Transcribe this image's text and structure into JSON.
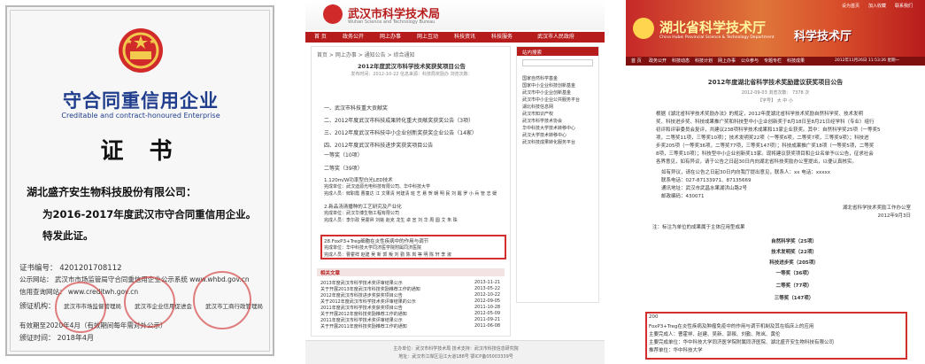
{
  "certificate": {
    "title": "守合同重信用企业",
    "subtitle": "Creditable and contract-honoured Enterprise",
    "heading": "证 书",
    "body_line1": "湖北盛齐安生物科技股份有限公司：",
    "body_line2": "为2016-2017年度武汉市守合同重信用企业。",
    "body_line3": "特发此证。",
    "cert_no": "证书编号：   4201201708112",
    "publicity": "公示网站：   武汉市市场监管局守合同重信用企业公示系统   www.whbd.gov.cn",
    "credit_site": "信用查询网站：   www.creditwh.gov.cn",
    "issuer_label": "颁证机构：",
    "issuer_1": "武汉市市场监督管理局",
    "issuer_2": "武汉市企业信用促进会",
    "issuer_3": "武汉市工商行政管理局",
    "validity": "有效期至2020年4月（有效期间每年需对外公示）",
    "issue_date": "颁证时间：   2018年4月"
  },
  "wuhan_page": {
    "site_title": "武汉市科学技术局",
    "site_title_en": "Wuhan Science and Technology Bureau",
    "nav": [
      "首 页",
      "政务公开",
      "网上办事",
      "网上互动",
      "科技资讯",
      "科技服务",
      "武汉市人民政府"
    ],
    "breadcrumb": "首页 > 网上办事 > 通知公告 > 综合通知",
    "article_title": "2012年度武汉市科学技术奖获奖项目公告",
    "article_meta": "发布时间：2012-10-22   信息来源：科技局奖励办   浏览次数：",
    "list_items": [
      "一、武汉市科技重大贡献奖",
      "二、2012年度武汉市科技成果转化重大贡献奖获奖公告（3项）",
      "三、2012年度武汉市科技中小企业创新奖获奖企业公告（14家）",
      "四、2012年度武汉市科技进步奖获奖项目公告",
      "一等奖（10项）",
      "二等奖（39项）"
    ],
    "project_1_title": "1.120m/W功率型白光LED技术",
    "project_1_unit": "完成单位：武汉迪源光电科技有限公司、华中科技大学",
    "project_1_people": "完成人员：鲜职霞 曹童达 江 文果清 何建清 班 艺 悬 贺 朝 明 民 刘 醒 罗 小 兵 管 志 媛",
    "project_2_title": "2.新品汤清播种的工艺研究及产业化",
    "project_2_unit": "完成单位：武汉华博生物工程有限公司",
    "project_2_people": "完成人员：李尔政 吴霍昇 刘姚 赵克 龙生 卓 宣 刘 华 周 圆 艾 朱 珠",
    "highlight_title": "28.FoxP3+Treg细胞在炎性疾病中的作用与调节",
    "highlight_unit": "完成单位：华中科技大学同济医学院附属同济医院",
    "highlight_people": "完成人员：曹霍祥 赵建 吴 新 郭 叛 刘 勤 陈 岚 等 明 陈 轩 李 淑",
    "related_header": "相关文章",
    "related": [
      "2013年度武汉市科学技术奖评审结果公示",
      "关于开展2013年度武汉市科技奖励推荐工作的通知",
      "2012年度武汉市科技进步奖获奖项目公告",
      "关于2012年度武汉市科学技术奖评审结果的公示",
      "2011年度武汉市科学技术奖获奖项目公告",
      "关于开展2012年度科技奖励推荐工作的通知",
      "2011年度武汉市科学技术奖评审结果公示",
      "关于开展2011年度科技奖励推荐工作的通知"
    ],
    "related_dates": [
      "2013-11-21",
      "2013-05-22",
      "2012-10-22",
      "2012-09-05",
      "2011-10-28",
      "2012-05-09",
      "2011-09-21",
      "2011-06-08"
    ],
    "sidebar_header": "站内搜索",
    "sidebar_links": [
      "国家自然科学基金",
      "国家中小企业科技创新基金",
      "武汉市中小企业创新基金",
      "武汉市中小企业公共服务平台",
      "湖北科技信息网",
      "武汉市知识产权",
      "武汉市科学技术协会",
      "华中科技大学技术转移中心",
      "武汉大学技术转移中心",
      "武汉科技成果转化服务平台"
    ],
    "footer_1": "主办单位：武汉市科学技术局  技术支持：武汉市科技信息研究院",
    "footer_2": "地址：武汉市江岸区沿江大道188号  鄂ICP备05003339号"
  },
  "hubei_page": {
    "site_title": "湖北省科学技术厅",
    "site_title_en": "China Hubei Provincial Science & Technology Department",
    "banner_text": "科学技术厅",
    "nav": [
      "首 页",
      "政务公开",
      "科技动态",
      "科技计划",
      "网上办事",
      "公众参与",
      "专题专栏",
      "科技成果"
    ],
    "top_links": [
      "设为首页",
      "加入收藏",
      "联系我们"
    ],
    "datetime": "2012年11月26日  11:53:26 星期一",
    "article_title": "2012年度湖北省科学技术奖励建议获奖项目公告",
    "article_meta": "2012-09-03   浏览次数： 7378 次",
    "font_size": "【字号】 大  中  小",
    "intro_lines": [
      "根据《湖北省科学技术奖励办法》的规定，2012年度湖北省科学技术奖励自然科学奖、技术发明",
      "奖、科技进步奖、科技成果推广奖和科技型中小企业创新奖于8月18日至8月21日经学科（专业）组行",
      "初评和评审委员会复评，共建议238项科学技术成果和13家企业获奖。其中：自然科学奖25项（一等奖5",
      "项，二等奖11项，三等奖10项）；技术发明奖22项（一等奖6项，二等奖7项，三等奖9项）；科技进",
      "步奖205项（一等奖36项，二等奖77项，三等奖147项）；科技成果推广奖18项（一等奖5项，二等奖",
      "8项，三等奖10项）；科技型中小企业创新奖13家。现将建议获奖项目和企业名单予以公告，征求社会",
      "各界意见，如有异议，请于公告之日起30日内向湖北省科技奖励办公室提出，以便认真核实。"
    ],
    "contact_lines": [
      "如有异议，请在公告之日起30日内向我厅提出意见，联系人：xx  电话：xxxxx",
      "联系电话：027-87133971、87135669",
      "通讯地址：武汉市武昌水果湖洪山路2号",
      "邮政编码：430071"
    ],
    "signature": "湖北省科学技术奖励工作办公室",
    "sign_date": "2012年9月3日",
    "note": "注：标注为单位的成果属于主体应用型成果",
    "category_list": [
      "自然科学奖（25项）",
      "技术发明奖（22项）",
      "科技进步奖（205项）",
      "一等奖（36项）",
      "二等奖（77项）",
      "三等奖（147项）"
    ],
    "highlight_no": "200",
    "highlight_title": "FoxP3+Treg在炎性疾病及肿瘤免疫中的作用与调节机制及其在临床上的应用",
    "highlight_people": "主要完成人：曹霍祥、赵建、吴新、郭叛、刘勤、陈岚、黄伦",
    "highlight_units": "主要完成单位：华中科技大学同济医学院附属同济医院、湖北盛齐安生物科技有限公司",
    "highlight_recommender": "推荐单位：华中科技大学"
  }
}
